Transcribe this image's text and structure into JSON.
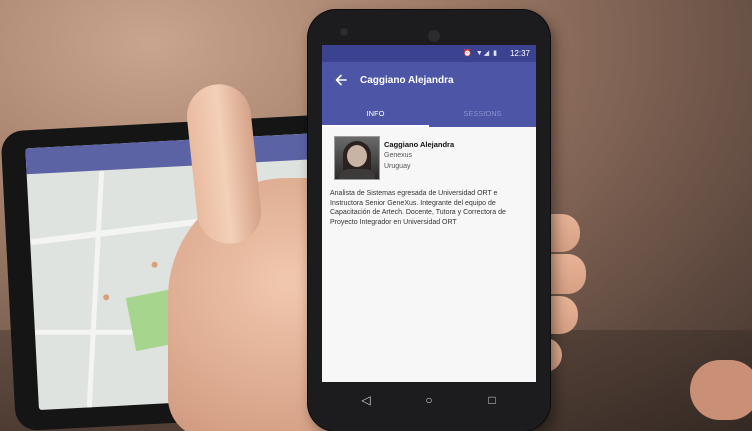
{
  "status_bar": {
    "icons": "⏰ ▼◢ ▮",
    "time": "12:37"
  },
  "app_bar": {
    "back_icon": "arrow-left-icon",
    "title": "Caggiano Alejandra"
  },
  "tabs": [
    {
      "label": "INFO",
      "selected": true
    },
    {
      "label": "SESSIONS",
      "selected": false
    }
  ],
  "profile": {
    "name": "Caggiano Alejandra",
    "company": "Genexus",
    "country": "Uruguay",
    "bio": "Analista de Sistemas egresada de Universidad ORT e Instructora Senior GeneXus. Integrante del equipo de Capacitación de Artech. Docente, Tutora y Correctora de Proyecto Integrador en Universidad ORT"
  },
  "nav_bar": {
    "back": "◁",
    "home": "○",
    "recent": "□"
  },
  "colors": {
    "app_bar": "#4c55a6",
    "status_bar": "#3b4390",
    "map_park": "#a6d68e"
  }
}
